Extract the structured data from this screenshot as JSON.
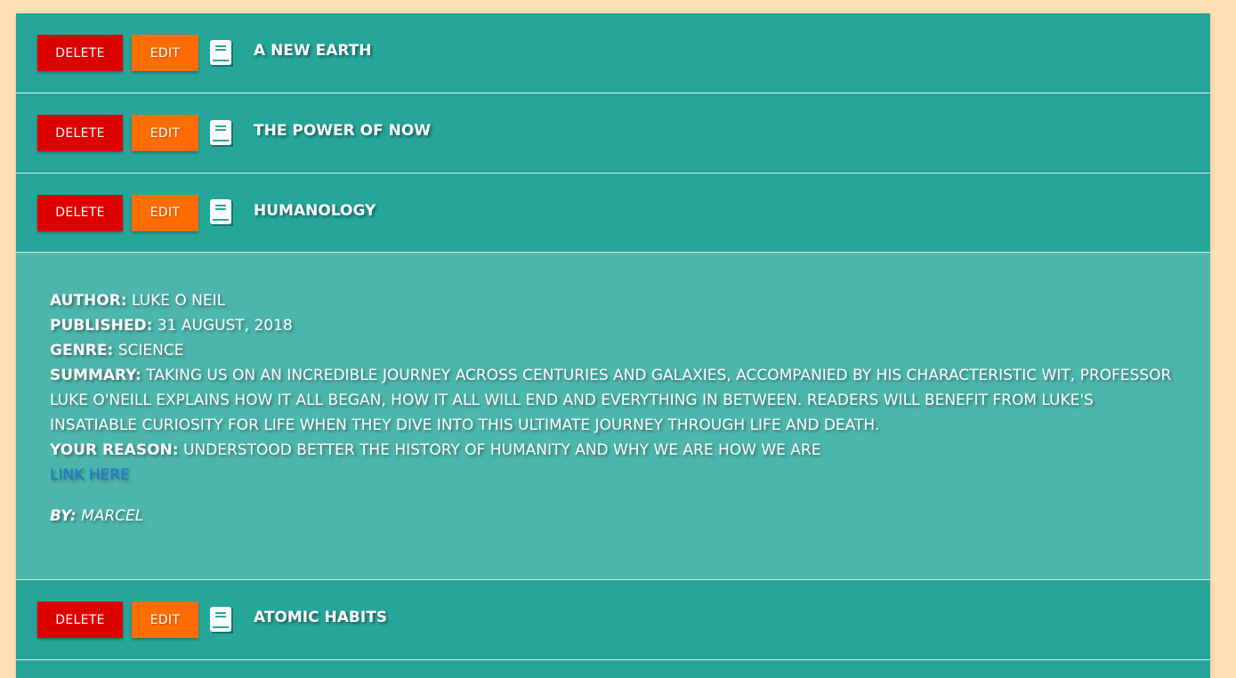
{
  "colors": {
    "page_bg": "#ffe0b2",
    "header_bg": "#26a69a",
    "body_bg": "#4db6ac",
    "delete_button": "#dd0000",
    "edit_button": "#ff6d00",
    "link": "#1976d2"
  },
  "icons": {
    "book": "book-icon"
  },
  "items": [
    {
      "delete_label": "DELETE",
      "edit_label": "EDIT",
      "title": "A NEW EARTH"
    },
    {
      "delete_label": "DELETE",
      "edit_label": "EDIT",
      "title": "THE POWER OF NOW"
    },
    {
      "delete_label": "DELETE",
      "edit_label": "EDIT",
      "title": "HUMANOLOGY",
      "expanded": true,
      "details": {
        "author_label": "AUTHOR:",
        "author": "LUKE O NEIL",
        "published_label": "PUBLISHED:",
        "published": "31 AUGUST, 2018",
        "genre_label": "GENRE:",
        "genre": "SCIENCE",
        "summary_label": "SUMMARY:",
        "summary": "TAKING US ON AN INCREDIBLE JOURNEY ACROSS CENTURIES AND GALAXIES, ACCOMPANIED BY HIS CHARACTERISTIC WIT, PROFESSOR LUKE O'NEILL EXPLAINS HOW IT ALL BEGAN, HOW IT ALL WILL END AND EVERYTHING IN BETWEEN. READERS WILL BENEFIT FROM LUKE'S INSATIABLE CURIOSITY FOR LIFE WHEN THEY DIVE INTO THIS ULTIMATE JOURNEY THROUGH LIFE AND DEATH.",
        "reason_label": "YOUR REASON:",
        "reason": "UNDERSTOOD BETTER THE HISTORY OF HUMANITY AND WHY WE ARE HOW WE ARE",
        "link_text": "LINK HERE",
        "by_label": "BY:",
        "by": "MARCEL"
      }
    },
    {
      "delete_label": "DELETE",
      "edit_label": "EDIT",
      "title": "ATOMIC HABITS"
    }
  ]
}
